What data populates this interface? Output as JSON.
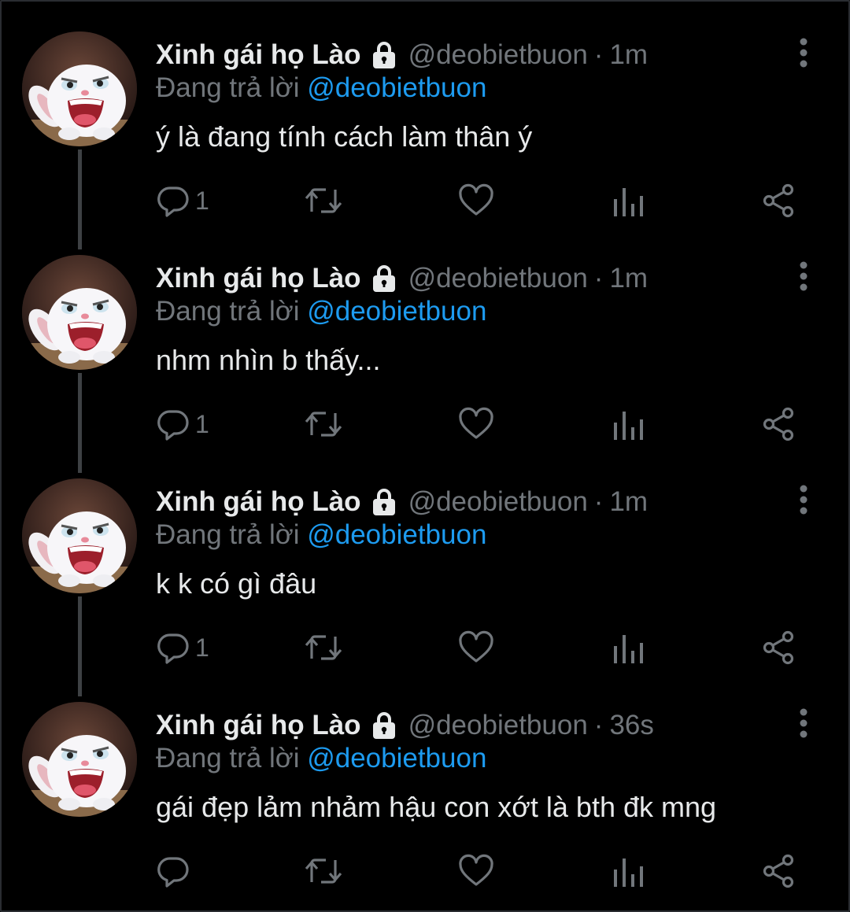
{
  "colors": {
    "background": "#000000",
    "text": "#e7e9ea",
    "muted": "#71767b",
    "accent": "#1d9bf0",
    "thread_line": "#3e4144"
  },
  "tweets": [
    {
      "author_name": "Xinh gái họ Lào",
      "lock_icon": "lock-icon",
      "handle": "@deobietbuon",
      "separator": "·",
      "time": "1m",
      "replying_prefix": "Đang trả lời",
      "replying_to": "@deobietbuon",
      "text": "ý là đang tính cách làm thân ý",
      "reply_count": "1"
    },
    {
      "author_name": "Xinh gái họ Lào",
      "lock_icon": "lock-icon",
      "handle": "@deobietbuon",
      "separator": "·",
      "time": "1m",
      "replying_prefix": "Đang trả lời",
      "replying_to": "@deobietbuon",
      "text": "nhm nhìn b thấy...",
      "reply_count": "1"
    },
    {
      "author_name": "Xinh gái họ Lào",
      "lock_icon": "lock-icon",
      "handle": "@deobietbuon",
      "separator": "·",
      "time": "1m",
      "replying_prefix": "Đang trả lời",
      "replying_to": "@deobietbuon",
      "text": "k k có gì đâu",
      "reply_count": "1"
    },
    {
      "author_name": "Xinh gái họ Lào",
      "lock_icon": "lock-icon",
      "handle": "@deobietbuon",
      "separator": "·",
      "time": "36s",
      "replying_prefix": "Đang trả lời",
      "replying_to": "@deobietbuon",
      "text": "gái đẹp lảm nhảm hậu con xớt là bth đk mng",
      "reply_count": ""
    }
  ]
}
